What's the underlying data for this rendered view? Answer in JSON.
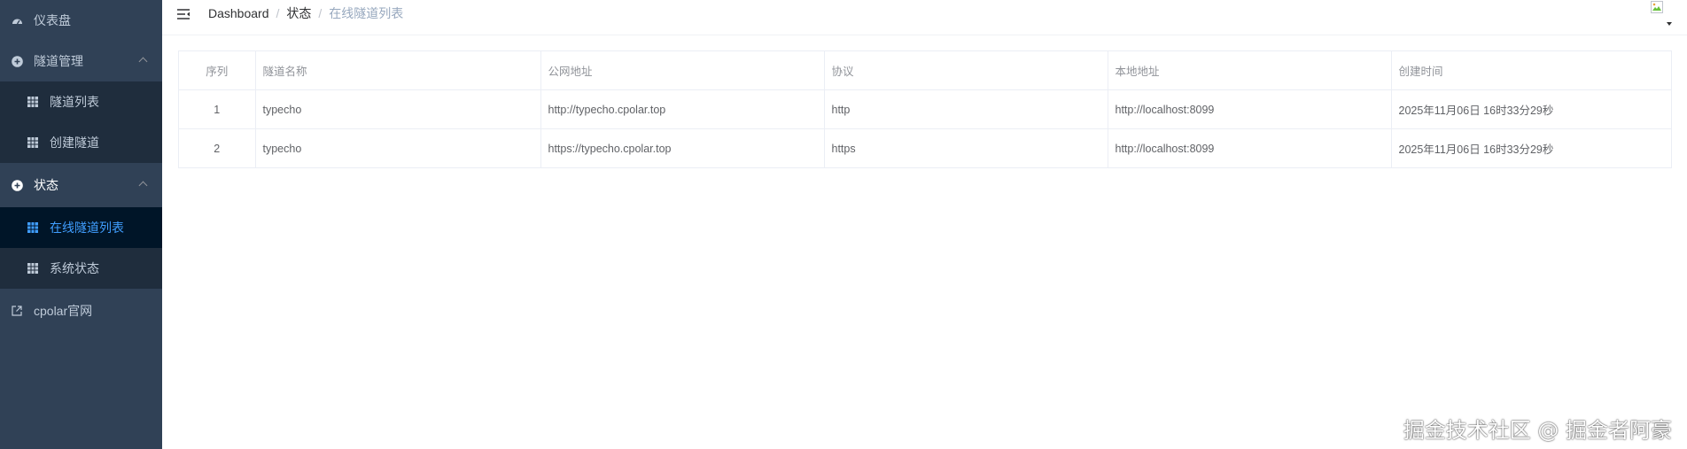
{
  "sidebar": {
    "items": [
      {
        "label": "仪表盘",
        "icon": "dashboard-icon"
      },
      {
        "label": "隧道管理",
        "icon": "plus-circle-icon"
      },
      {
        "label": "隧道列表",
        "icon": "grid-icon"
      },
      {
        "label": "创建隧道",
        "icon": "grid-icon"
      },
      {
        "label": "状态",
        "icon": "plus-circle-icon"
      },
      {
        "label": "在线隧道列表",
        "icon": "grid-icon"
      },
      {
        "label": "系统状态",
        "icon": "grid-icon"
      },
      {
        "label": "cpolar官网",
        "icon": "external-link-icon"
      }
    ],
    "colors": {
      "bg": "#304156",
      "submenu_bg": "#1f2d3d",
      "active_bg": "#001528",
      "active_text": "#409eff"
    }
  },
  "navbar": {
    "breadcrumb": [
      "Dashboard",
      "状态",
      "在线隧道列表"
    ]
  },
  "table": {
    "headers": [
      "序列",
      "隧道名称",
      "公网地址",
      "协议",
      "本地地址",
      "创建时间"
    ],
    "rows": [
      [
        "1",
        "typecho",
        "http://typecho.cpolar.top",
        "http",
        "http://localhost:8099",
        "2025年11月06日 16时33分29秒"
      ],
      [
        "2",
        "typecho",
        "https://typecho.cpolar.top",
        "https",
        "http://localhost:8099",
        "2025年11月06日 16时33分29秒"
      ]
    ]
  },
  "watermark": "掘金技术社区 @ 掘金者阿豪"
}
